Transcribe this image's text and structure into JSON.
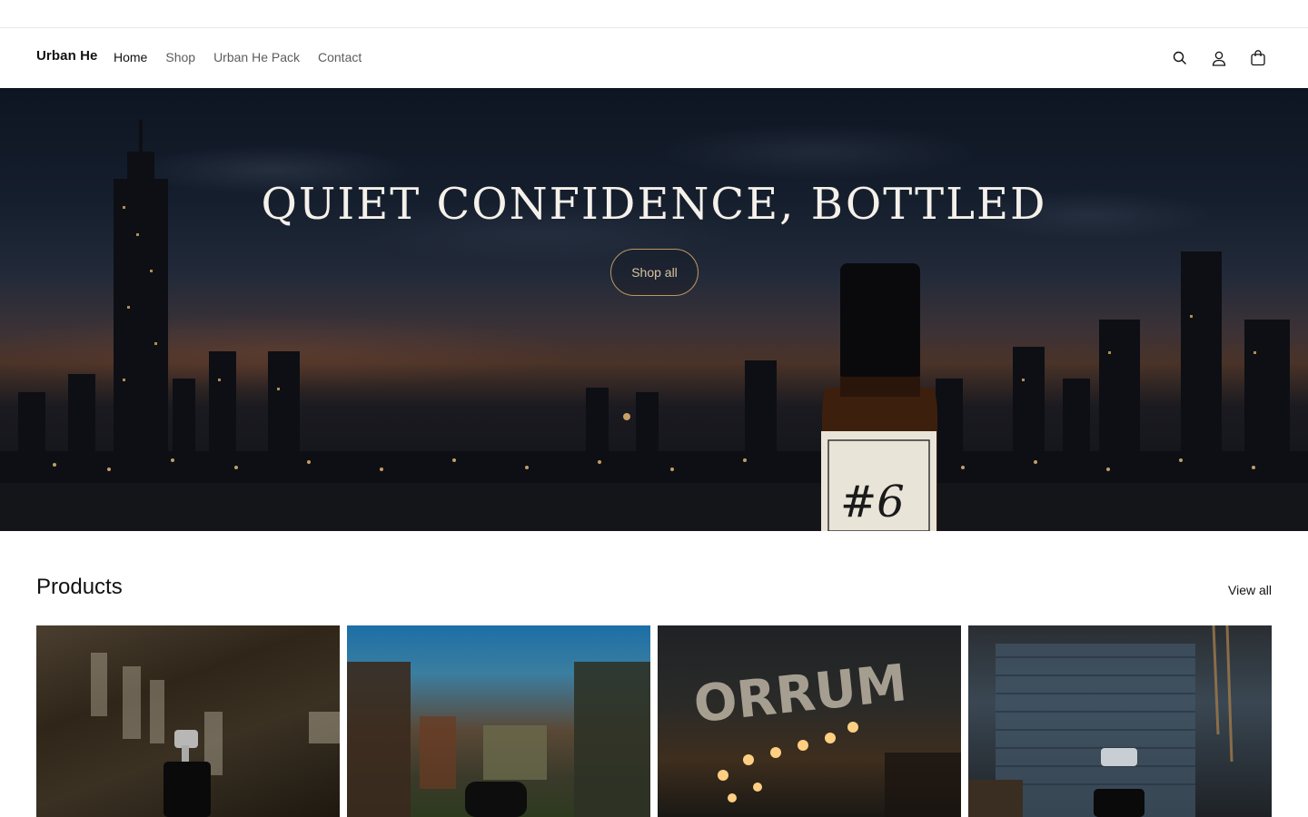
{
  "header": {
    "logo": "Urban He",
    "nav": [
      {
        "label": "Home",
        "active": true
      },
      {
        "label": "Shop",
        "active": false
      },
      {
        "label": "Urban He Pack",
        "active": false
      },
      {
        "label": "Contact",
        "active": false
      }
    ],
    "icons": [
      "search-icon",
      "account-icon",
      "cart-icon"
    ]
  },
  "hero": {
    "title": "QUIET CONFIDENCE, BOTTLED",
    "button_label": "Shop all",
    "bottle_label": "#6"
  },
  "products": {
    "title": "Products",
    "view_all_label": "View all"
  },
  "colors": {
    "button_border": "#b99863",
    "text_dark": "#121212",
    "nav_muted": "#5c5c5c"
  }
}
